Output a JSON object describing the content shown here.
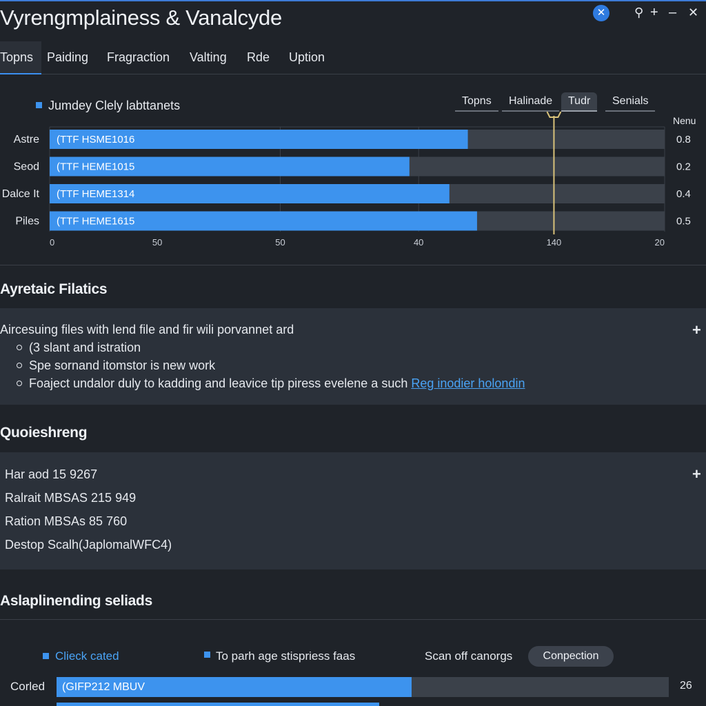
{
  "window": {
    "title": "Vyrengmplainess & Vanalcyde",
    "close_icon": "close-icon",
    "tool_icons": [
      "key-icon",
      "plus-icon",
      "minimize-icon",
      "close-x-icon"
    ]
  },
  "tabs": [
    {
      "label": "Topns",
      "active": true
    },
    {
      "label": "Paiding",
      "active": false
    },
    {
      "label": "Fragraction",
      "active": false
    },
    {
      "label": "Valting",
      "active": false
    },
    {
      "label": "Rde",
      "active": false
    },
    {
      "label": "Uption",
      "active": false
    }
  ],
  "chart_section": {
    "legend_label": "Jumdey Clely  labttanets",
    "chips": [
      {
        "label": "Topns",
        "active": false
      },
      {
        "label": "Halinade",
        "active": false
      },
      {
        "label": "Tudr",
        "active": true
      },
      {
        "label": "Senials",
        "active": false
      }
    ],
    "right_header": "Nenu"
  },
  "chart_data": {
    "type": "bar",
    "orientation": "horizontal",
    "categories": [
      "Astre",
      "Seod",
      "Dalce It",
      "Piles"
    ],
    "bar_labels": [
      "(TTF HSME1016",
      "(TTF HEME1015",
      "(TTF HEME1314",
      "(TTF HEME1615"
    ],
    "values": [
      0.68,
      0.585,
      0.65,
      0.695
    ],
    "right_values": [
      "0.8",
      "0.2",
      "0.4",
      "0.5"
    ],
    "x_tick_labels": [
      "0",
      "50",
      "50",
      "40",
      "140",
      "20"
    ],
    "grid": true,
    "marker": {
      "position": 0.82,
      "color": "#d9c27a"
    },
    "colors": {
      "bar": "#3d93ee",
      "track": "#3b414a"
    }
  },
  "filatics": {
    "title": "Ayretaic Filatics",
    "intro": "Aircesuing files with lend file and fir wili porvannet ard",
    "bullets": [
      {
        "text": "(3 slant and istration",
        "link": ""
      },
      {
        "text": "Spe sornand itomstor is new work",
        "link": ""
      },
      {
        "text": "Foaject undalor duly to kadding and leavice tip piress evelene a such ",
        "link": "Reg inodier holondin"
      }
    ],
    "expand_icon": "plus-icon"
  },
  "quoieshreng": {
    "title": "Quoieshreng",
    "rows": [
      "Har aod 15 9267",
      "Ralrait MBSAS 215 949",
      "Ration MBSAs 85 760",
      "Destop Scalh(JaplomalWFC4)"
    ],
    "expand_icon": "plus-icon"
  },
  "bottom": {
    "title": "Aslaplinending seliads",
    "legend": [
      {
        "label": "Clieck cated",
        "highlight": true
      },
      {
        "label": "To parh age stispriess faas",
        "highlight": false
      }
    ],
    "scan_label": "Scan off canorgs",
    "button_label": "Conpection",
    "row_label": "Corled",
    "bar_label": "(GIFP212 MBUV",
    "bar_value": 0.58,
    "right_value": "26"
  }
}
